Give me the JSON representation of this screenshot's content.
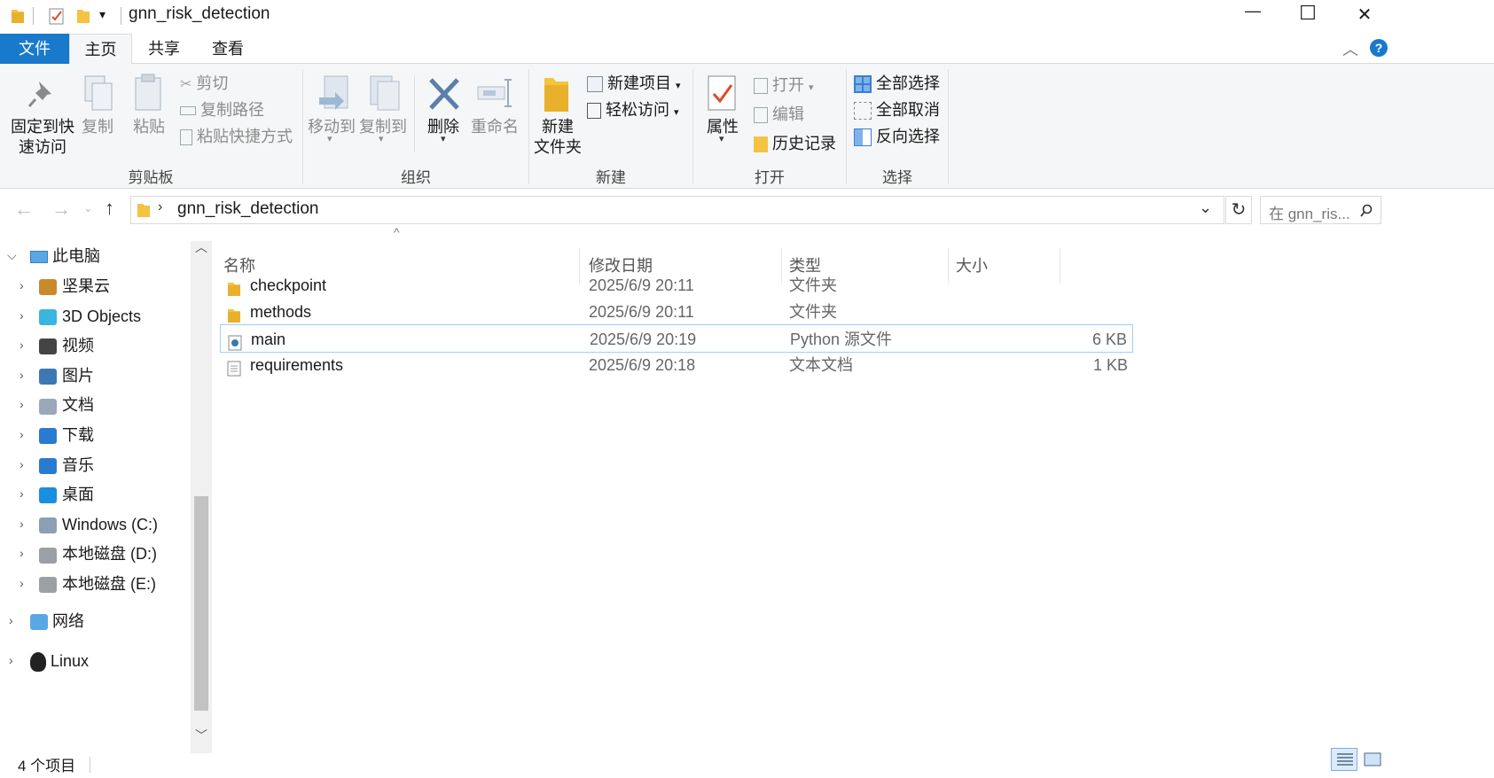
{
  "window": {
    "title": "gnn_risk_detection",
    "controls": {
      "minimize": "—",
      "maximize": "☐",
      "close": "✕"
    }
  },
  "ribbon_tabs": {
    "file": "文件",
    "home": "主页",
    "share": "共享",
    "view": "查看"
  },
  "ribbon": {
    "clipboard": {
      "pin_line1": "固定到快",
      "pin_line2": "速访问",
      "copy": "复制",
      "paste": "粘贴",
      "cut": "剪切",
      "copy_path": "复制路径",
      "paste_shortcut": "粘贴快捷方式",
      "label": "剪贴板"
    },
    "organize": {
      "move_to": "移动到",
      "copy_to": "复制到",
      "delete": "删除",
      "rename": "重命名",
      "label": "组织"
    },
    "new": {
      "new_folder_line1": "新建",
      "new_folder_line2": "文件夹",
      "new_item": "新建项目",
      "easy_access": "轻松访问",
      "label": "新建"
    },
    "open": {
      "properties": "属性",
      "open": "打开",
      "edit": "编辑",
      "history": "历史记录",
      "label": "打开"
    },
    "select": {
      "select_all": "全部选择",
      "select_none": "全部取消",
      "invert": "反向选择",
      "label": "选择"
    }
  },
  "address": {
    "path": "gnn_risk_detection",
    "search_placeholder": "在 gnn_ris..."
  },
  "nav": {
    "this_pc": "此电脑",
    "items": [
      {
        "label": "坚果云",
        "icon": "nutstore-icon"
      },
      {
        "label": "3D Objects",
        "icon": "cube-icon"
      },
      {
        "label": "视频",
        "icon": "video-icon"
      },
      {
        "label": "图片",
        "icon": "pictures-icon"
      },
      {
        "label": "文档",
        "icon": "documents-icon"
      },
      {
        "label": "下载",
        "icon": "download-icon"
      },
      {
        "label": "音乐",
        "icon": "music-icon"
      },
      {
        "label": "桌面",
        "icon": "desktop-icon"
      },
      {
        "label": "Windows (C:)",
        "icon": "windows-drive-icon"
      },
      {
        "label": "本地磁盘 (D:)",
        "icon": "drive-icon"
      },
      {
        "label": "本地磁盘 (E:)",
        "icon": "drive-icon"
      }
    ],
    "network": "网络",
    "linux": "Linux"
  },
  "columns": {
    "name": "名称",
    "date": "修改日期",
    "type": "类型",
    "size": "大小"
  },
  "files": [
    {
      "name": "checkpoint",
      "date": "2025/6/9 20:11",
      "type": "文件夹",
      "size": "",
      "icon": "folder-icon"
    },
    {
      "name": "methods",
      "date": "2025/6/9 20:11",
      "type": "文件夹",
      "size": "",
      "icon": "folder-icon"
    },
    {
      "name": "main",
      "date": "2025/6/9 20:19",
      "type": "Python 源文件",
      "size": "6 KB",
      "icon": "python-file-icon"
    },
    {
      "name": "requirements",
      "date": "2025/6/9 20:18",
      "type": "文本文档",
      "size": "1 KB",
      "icon": "text-file-icon"
    }
  ],
  "status": {
    "item_count": "4 个项目"
  },
  "colors": {
    "file_tab": "#1979ca",
    "folder": "#f5c342",
    "selection_border": "#99d1ff",
    "help": "#1979ca"
  }
}
